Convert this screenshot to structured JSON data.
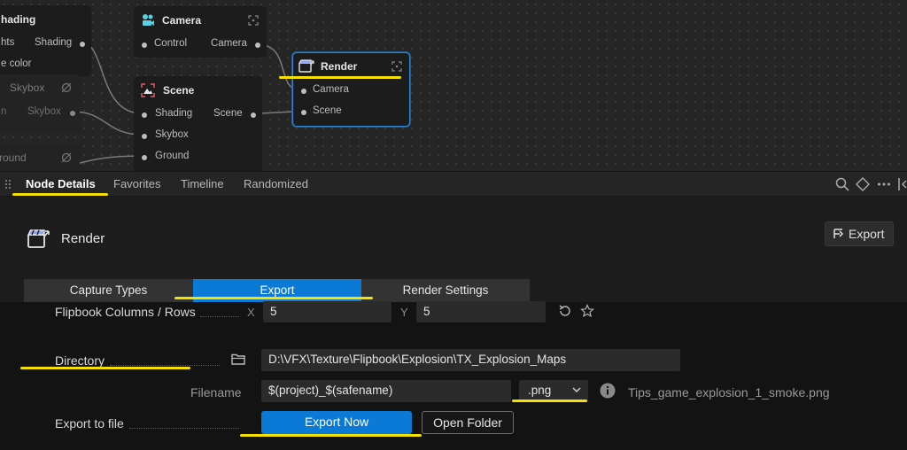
{
  "graph": {
    "shading_node": {
      "title": "hading",
      "input_lights": "hts",
      "output_shading": "Shading",
      "input_color": "e color"
    },
    "skybox_node": {
      "title": "Skybox",
      "output_skybox": "Skybox",
      "input_partial": "n"
    },
    "ground_node": {
      "title": "round"
    },
    "camera_node": {
      "title": "Camera",
      "input_control": "Control",
      "output_camera": "Camera"
    },
    "scene_node": {
      "title": "Scene",
      "input_shading": "Shading",
      "input_skybox": "Skybox",
      "input_ground": "Ground",
      "output_scene": "Scene"
    },
    "render_node": {
      "title": "Render",
      "input_camera": "Camera",
      "input_scene": "Scene"
    }
  },
  "panel_tabs": [
    "Node Details",
    "Favorites",
    "Timeline",
    "Randomized"
  ],
  "panel_toolbar_icons": [
    "search-icon",
    "diamond-icon",
    "more-icon",
    "collapse-icon"
  ],
  "details": {
    "node_title": "Render",
    "export_button": "Export",
    "section_tabs": [
      "Capture Types",
      "Export",
      "Render Settings"
    ],
    "active_section": "Export"
  },
  "form": {
    "flipbook_label": "Flipbook Columns / Rows",
    "x_label": "X",
    "x_value": "5",
    "y_label": "Y",
    "y_value": "5",
    "directory_label": "Directory",
    "directory_value": "D:\\VFX\\Texture\\Flipbook\\Explosion\\TX_Explosion_Maps",
    "filename_label": "Filename",
    "filename_value": "$(project)_$(safename)",
    "extension_value": ".png",
    "resolved_filename": "Tips_game_explosion_1_smoke.png",
    "export_to_file_label": "Export to file",
    "export_now_button": "Export Now",
    "open_folder_button": "Open Folder"
  },
  "colors": {
    "accent": "#0b7ad6",
    "highlight": "#f5e000",
    "selection_border": "#2f86d6"
  }
}
